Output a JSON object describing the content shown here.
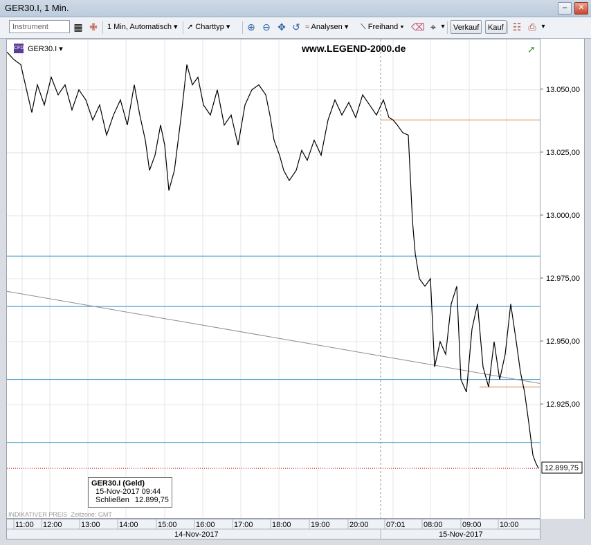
{
  "window": {
    "title": "GER30.I, 1 Min."
  },
  "toolbar": {
    "instrument_placeholder": "Instrument",
    "interval": "1 Min,  Automatisch",
    "charttyp": "Charttyp",
    "analysen": "Analysen",
    "freihand": "Freihand",
    "sell": "Verkauf",
    "buy": "Kauf"
  },
  "chart_header": {
    "symbol": "GER30.I",
    "watermark": "www.LEGEND-2000.de"
  },
  "footer": {
    "indikativ": "INDIKATIVER PREIS",
    "zeitzone": "Zeitzone: GMT"
  },
  "tooltip": {
    "title": "GER30.I (Geld)",
    "datetime": "15-Nov-2017 09:44",
    "close_label": "Schließen",
    "close_value": "12.899,75"
  },
  "chart_data": {
    "type": "line",
    "y_ticks": [
      "13.050,00",
      "13.025,00",
      "13.000,00",
      "12.975,00",
      "12.950,00",
      "12.925,00"
    ],
    "ylim": [
      12880,
      13070
    ],
    "x_ticks": [
      "11:00",
      "12:00",
      "13:00",
      "14:00",
      "15:00",
      "16:00",
      "17:00",
      "18:00",
      "19:00",
      "20:00",
      "07:01",
      "08:00",
      "09:00",
      "10:00"
    ],
    "date_labels": [
      "14-Nov-2017",
      "15-Nov-2017"
    ],
    "last_price_label": "12.899,75",
    "last_price": 12899.75,
    "colors": {
      "price": "#000000",
      "hline": "#2b8fbf",
      "orange": "#d9772b",
      "trend": "#8c8c8c",
      "last": "#c00000"
    },
    "price_series": [
      [
        0,
        13065
      ],
      [
        5,
        13062
      ],
      [
        10,
        13060
      ],
      [
        15,
        13048
      ],
      [
        18,
        13041
      ],
      [
        22,
        13052
      ],
      [
        27,
        13044
      ],
      [
        32,
        13055
      ],
      [
        37,
        13048
      ],
      [
        42,
        13052
      ],
      [
        47,
        13042
      ],
      [
        52,
        13050
      ],
      [
        57,
        13046
      ],
      [
        62,
        13038
      ],
      [
        67,
        13044
      ],
      [
        72,
        13032
      ],
      [
        77,
        13040
      ],
      [
        82,
        13046
      ],
      [
        87,
        13036
      ],
      [
        92,
        13052
      ],
      [
        96,
        13040
      ],
      [
        100,
        13030
      ],
      [
        103,
        13018
      ],
      [
        107,
        13024
      ],
      [
        111,
        13036
      ],
      [
        114,
        13028
      ],
      [
        117,
        13010
      ],
      [
        121,
        13018
      ],
      [
        126,
        13040
      ],
      [
        130,
        13060
      ],
      [
        134,
        13052
      ],
      [
        138,
        13055
      ],
      [
        142,
        13044
      ],
      [
        147,
        13040
      ],
      [
        152,
        13050
      ],
      [
        157,
        13036
      ],
      [
        162,
        13040
      ],
      [
        167,
        13028
      ],
      [
        172,
        13044
      ],
      [
        177,
        13050
      ],
      [
        182,
        13052
      ],
      [
        187,
        13048
      ],
      [
        190,
        13040
      ],
      [
        193,
        13030
      ],
      [
        197,
        13024
      ],
      [
        200,
        13018
      ],
      [
        204,
        13014
      ],
      [
        209,
        13018
      ],
      [
        213,
        13026
      ],
      [
        217,
        13022
      ],
      [
        222,
        13030
      ],
      [
        227,
        13024
      ],
      [
        232,
        13038
      ],
      [
        237,
        13046
      ],
      [
        242,
        13040
      ],
      [
        247,
        13045
      ],
      [
        252,
        13039
      ],
      [
        257,
        13048
      ],
      [
        262,
        13044
      ],
      [
        267,
        13040
      ],
      [
        272,
        13046
      ],
      [
        276,
        13039
      ],
      [
        279,
        13038
      ],
      [
        282,
        13036
      ],
      [
        286,
        13033
      ],
      [
        290,
        13032
      ],
      [
        293,
        12998
      ],
      [
        295,
        12985
      ],
      [
        298,
        12975
      ],
      [
        302,
        12972
      ],
      [
        306,
        12975
      ],
      [
        309,
        12940
      ],
      [
        313,
        12950
      ],
      [
        317,
        12945
      ],
      [
        321,
        12965
      ],
      [
        325,
        12972
      ],
      [
        328,
        12935
      ],
      [
        332,
        12930
      ],
      [
        336,
        12955
      ],
      [
        340,
        12965
      ],
      [
        344,
        12940
      ],
      [
        348,
        12932
      ],
      [
        352,
        12950
      ],
      [
        356,
        12935
      ],
      [
        360,
        12945
      ],
      [
        364,
        12965
      ],
      [
        368,
        12950
      ],
      [
        371,
        12938
      ],
      [
        374,
        12930
      ],
      [
        377,
        12918
      ],
      [
        380,
        12905
      ],
      [
        382,
        12902
      ],
      [
        384,
        12899.75
      ]
    ],
    "horizontal_levels": [
      12984,
      12964,
      12935,
      12910
    ],
    "orange_levels": [
      13038,
      12932
    ],
    "trendline": [
      [
        0,
        12970
      ],
      [
        400,
        12932
      ]
    ]
  }
}
